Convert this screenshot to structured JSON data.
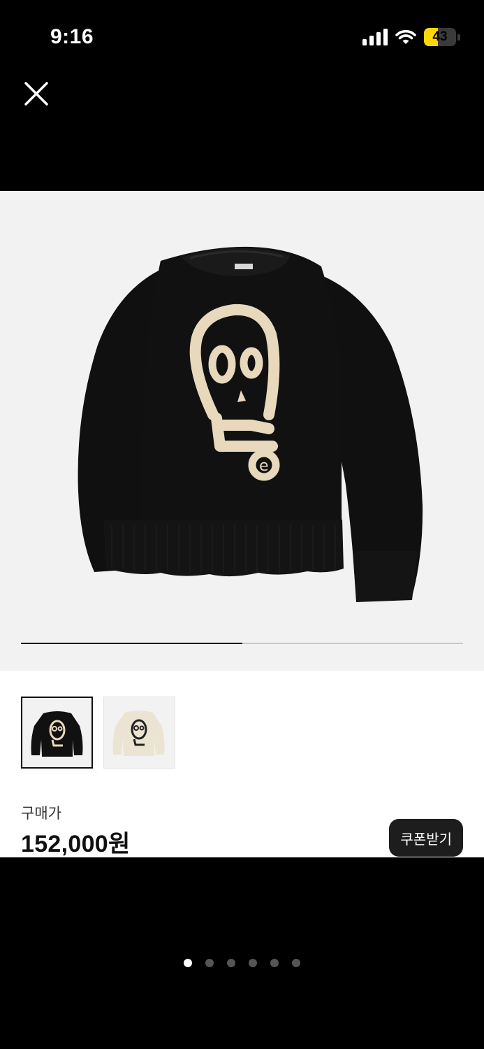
{
  "status_bar": {
    "time": "9:16",
    "battery_level": "43",
    "battery_fraction": 0.43,
    "battery_color": "#ffd60a",
    "icons": [
      "cellular-signal-icon",
      "wifi-icon",
      "battery-icon"
    ]
  },
  "close_icon": "close-icon",
  "gallery": {
    "progress_fraction": 0.5,
    "thumbnails": [
      {
        "alt": "black sweater",
        "color": "#111111",
        "selected": true
      },
      {
        "alt": "cream sweater",
        "color": "#ece4d3",
        "selected": false
      }
    ]
  },
  "product": {
    "price_label": "구매가",
    "price_value": "152,000원"
  },
  "coupon": {
    "label": "쿠폰받기"
  },
  "pager": {
    "total": 6,
    "active_index": 0
  },
  "colors": {
    "background": "#000000",
    "sheet": "#ffffff",
    "hero_bg": "#f2f2f2",
    "sweater": "#111111",
    "skull_graphic": "#e8d8bc",
    "cream_sweater": "#ece4d3"
  }
}
